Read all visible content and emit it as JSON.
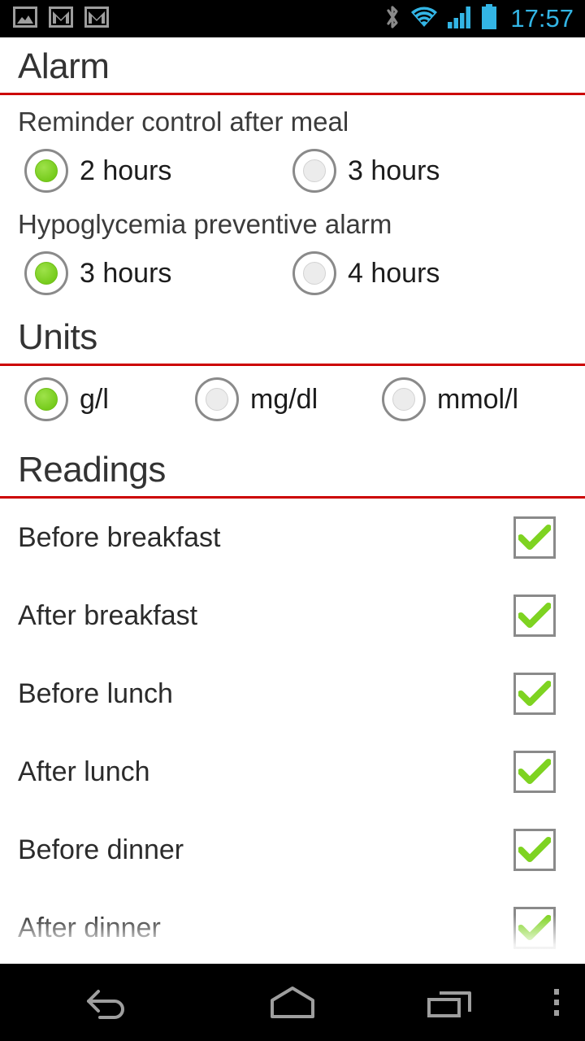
{
  "status_bar": {
    "left_icons": [
      {
        "name": "gallery-image-icon",
        "label": "Screenshot captured"
      },
      {
        "name": "gmail-icon",
        "label": "Gmail"
      },
      {
        "name": "gmail-icon",
        "label": "Gmail"
      }
    ],
    "right_icons": [
      {
        "name": "bluetooth-icon",
        "color": "#8a8a8a"
      },
      {
        "name": "wifi-icon",
        "color": "#33b5e5"
      },
      {
        "name": "cellular-signal-icon",
        "color": "#33b5e5"
      },
      {
        "name": "battery-icon",
        "color": "#33b5e5"
      }
    ],
    "clock": "17:57",
    "clock_color": "#33b5e5",
    "background": "#000000"
  },
  "theme": {
    "accent_rule": "#cc0000",
    "selected_green": "#7ed321",
    "page_background": "#ffffff",
    "text_primary": "#2b2b2b"
  },
  "sections": {
    "alarm": {
      "title": "Alarm",
      "groups": [
        {
          "label": "Reminder control after meal",
          "options": [
            {
              "label": "2 hours",
              "selected": true
            },
            {
              "label": "3 hours",
              "selected": false
            }
          ]
        },
        {
          "label": "Hypoglycemia preventive alarm",
          "options": [
            {
              "label": "3 hours",
              "selected": true
            },
            {
              "label": "4 hours",
              "selected": false
            }
          ]
        }
      ]
    },
    "units": {
      "title": "Units",
      "options": [
        {
          "label": "g/l",
          "selected": true
        },
        {
          "label": "mg/dl",
          "selected": false
        },
        {
          "label": "mmol/l",
          "selected": false
        }
      ]
    },
    "readings": {
      "title": "Readings",
      "items": [
        {
          "label": "Before breakfast",
          "checked": true
        },
        {
          "label": "After breakfast",
          "checked": true
        },
        {
          "label": "Before lunch",
          "checked": true
        },
        {
          "label": "After lunch",
          "checked": true
        },
        {
          "label": "Before dinner",
          "checked": true
        },
        {
          "label": "After dinner",
          "checked": true
        }
      ]
    }
  },
  "nav_bar": {
    "buttons": [
      {
        "name": "back-icon",
        "label": "Back"
      },
      {
        "name": "home-icon",
        "label": "Home"
      },
      {
        "name": "recent-apps-icon",
        "label": "Recent apps"
      },
      {
        "name": "overflow-menu-icon",
        "label": "Menu"
      }
    ],
    "background": "#000000",
    "icon_color": "#9e9e9e"
  }
}
